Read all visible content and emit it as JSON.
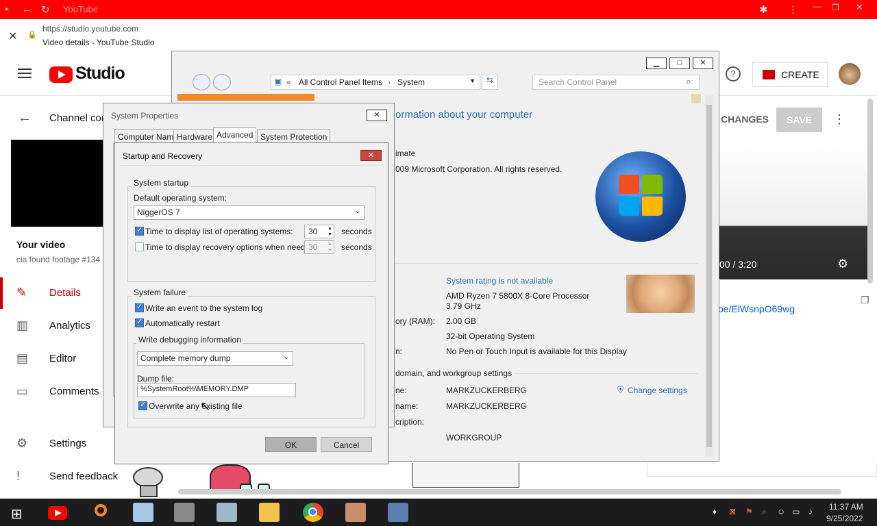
{
  "browser": {
    "tab_title": "YouTube",
    "url": "https://studio.youtube.com",
    "page_title": "Video details - YouTube Studio"
  },
  "studio": {
    "logo_text": "Studio",
    "create_label": "CREATE",
    "channel_title": "Channel con",
    "your_video_label": "Your video",
    "video_subtitle": "cia found footage #134",
    "undo_changes": "CHANGES",
    "save_label": "SAVE",
    "timecode": "00 / 3:20",
    "video_link": "be/ElWsnpO69wg",
    "nav": [
      {
        "label": "Details",
        "icon": "pencil-icon",
        "active": true
      },
      {
        "label": "Analytics",
        "icon": "bar-chart-icon",
        "active": false
      },
      {
        "label": "Editor",
        "icon": "film-icon",
        "active": false
      },
      {
        "label": "Comments",
        "icon": "comment-icon",
        "active": false
      },
      {
        "label": "Settings",
        "icon": "gear-icon",
        "active": false
      },
      {
        "label": "Send feedback",
        "icon": "feedback-icon",
        "active": false
      }
    ]
  },
  "control_panel": {
    "breadcrumb": [
      "All Control Panel Items",
      "System"
    ],
    "search_placeholder": "Search Control Panel",
    "heading": "ormation about your computer",
    "edition": "imate",
    "copyright": "009 Microsoft Corporation.  All rights reserved.",
    "system_rating": "System rating is not available",
    "processor": "AMD Ryzen 7 5800X 8-Core Processor",
    "processor_speed": "3.79 GHz",
    "memory_label": "ory (RAM):",
    "memory_value": "2.00 GB",
    "system_type": "32-bit Operating System",
    "pen_label": "n:",
    "pen_value": "No Pen or Touch Input is available for this Display",
    "section_heading": "domain, and workgroup settings",
    "computer_name_label": "ne:",
    "computer_name": "MARKZUCKERBERG",
    "full_name_label": "name:",
    "full_name": "MARKZUCKERBERG",
    "description_label": "cription:",
    "workgroup": "WORKGROUP",
    "change_settings": "Change settings"
  },
  "system_properties": {
    "title": "System Properties",
    "tabs": [
      "Computer Name",
      "Hardware",
      "Advanced",
      "System Protection"
    ],
    "active_tab": "Advanced"
  },
  "startup_recovery": {
    "title": "Startup and Recovery",
    "system_startup_label": "System startup",
    "default_os_label": "Default operating system:",
    "default_os_value": "NiggerOS 7",
    "display_list_label": "Time to display list of operating systems:",
    "display_list_value": "30",
    "display_list_checked": true,
    "recovery_label": "Time to display recovery options when needed:",
    "recovery_value": "30",
    "recovery_checked": false,
    "seconds": "seconds",
    "system_failure_label": "System failure",
    "write_event_label": "Write an event to the system log",
    "auto_restart_label": "Automatically restart",
    "debug_info_label": "Write debugging information",
    "debug_type": "Complete memory dump",
    "dump_file_label": "Dump file:",
    "dump_file_value": "%SystemRoot%\\MEMORY.DMP",
    "overwrite_label": "Overwrite any existing file",
    "ok_label": "OK",
    "cancel_label": "Cancel"
  },
  "taskbar": {
    "time": "11:37 AM",
    "date": "9/25/2022"
  }
}
